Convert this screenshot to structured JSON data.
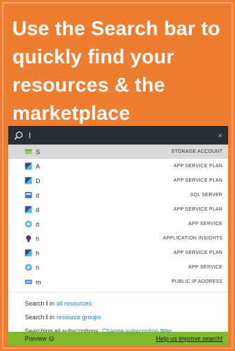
{
  "headline": "Use the Search bar to quickly find your resources & the marketplace",
  "search": {
    "query": "l",
    "close": "×"
  },
  "results": [
    {
      "name": "S",
      "type": "STORAGE ACCOUNT",
      "icon": "storage-account-icon",
      "selected": true
    },
    {
      "name": "A",
      "type": "APP SERVICE PLAN",
      "icon": "app-service-plan-icon"
    },
    {
      "name": "D",
      "type": "APP SERVICE PLAN",
      "icon": "app-service-plan-icon"
    },
    {
      "name": "d",
      "type": "SQL SERVER",
      "icon": "sql-server-icon"
    },
    {
      "name": "d",
      "type": "APP SERVICE PLAN",
      "icon": "app-service-plan-icon"
    },
    {
      "name": "d",
      "type": "APP SERVICE",
      "icon": "app-service-icon"
    },
    {
      "name": "h",
      "type": "APPLICATION INSIGHTS",
      "icon": "application-insights-icon"
    },
    {
      "name": "h",
      "type": "APP SERVICE PLAN",
      "icon": "app-service-plan-icon"
    },
    {
      "name": "h",
      "type": "APP SERVICE",
      "icon": "app-service-icon"
    },
    {
      "name": "m",
      "type": "PUBLIC IP ADDRESS",
      "icon": "public-ip-icon"
    }
  ],
  "links": {
    "search_prefix": "Search",
    "query_word": "l",
    "in_word": "in",
    "all_resources": "all resources",
    "resource_groups": "resource groups",
    "searching_text": "Searching all subscriptions.",
    "change_filter": "Change subscription filter."
  },
  "footer": {
    "preview": "Preview",
    "improve": "Help us improve search!"
  },
  "colors": {
    "background": "#ed7d31",
    "search_bar": "#2a2f34",
    "link": "#1b88cc",
    "footer": "#7db92b"
  }
}
